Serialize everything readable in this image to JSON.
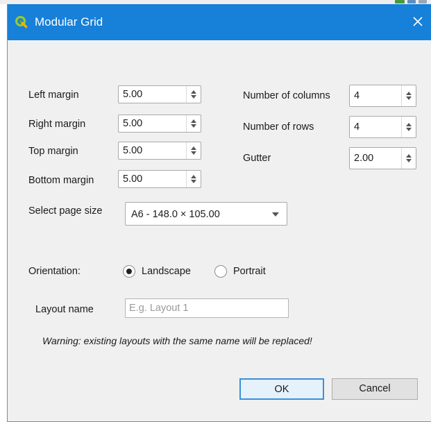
{
  "dialog": {
    "title": "Modular Grid",
    "colors": {
      "titlebar": "#1780d8",
      "background": "#f0f0f0",
      "ok_border": "#3b8ed8"
    }
  },
  "icons": [
    "qgis-logo-icon",
    "close-icon",
    "spin-arrows-icon",
    "dropdown-arrow-icon"
  ],
  "margins": {
    "left": {
      "label": "Left margin",
      "value": "5.00"
    },
    "right": {
      "label": "Right margin",
      "value": "5.00"
    },
    "top": {
      "label": "Top margin",
      "value": "5.00"
    },
    "bottom": {
      "label": "Bottom margin",
      "value": "5.00"
    }
  },
  "grid": {
    "columns": {
      "label": "Number of columns",
      "value": "4"
    },
    "rows": {
      "label": "Number of rows",
      "value": "4"
    },
    "gutter": {
      "label": "Gutter",
      "value": "2.00"
    }
  },
  "page_size": {
    "label": "Select page size",
    "value": "A6 - 148.0 × 105.00"
  },
  "orientation": {
    "label": "Orientation:",
    "options": [
      {
        "label": "Landscape",
        "selected": true
      },
      {
        "label": "Portrait",
        "selected": false
      }
    ]
  },
  "layout_name": {
    "label": "Layout name",
    "value": "",
    "placeholder": "E.g. Layout 1"
  },
  "warning": "Warning: existing layouts with the same name will be replaced!",
  "buttons": {
    "ok": "OK",
    "cancel": "Cancel"
  }
}
